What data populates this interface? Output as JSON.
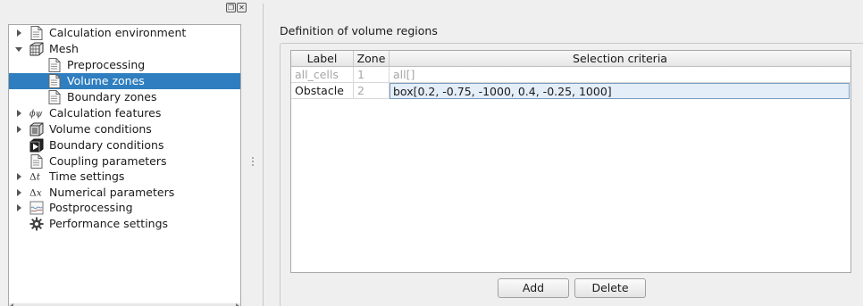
{
  "tree": {
    "items": [
      {
        "label": "Calculation environment",
        "icon": "document-icon",
        "expander": "collapsed",
        "indent": 0
      },
      {
        "label": "Mesh",
        "icon": "mesh-cube-icon",
        "expander": "expanded",
        "indent": 0
      },
      {
        "label": "Preprocessing",
        "icon": "document-icon",
        "expander": "none",
        "indent": 1
      },
      {
        "label": "Volume zones",
        "icon": "document-icon",
        "expander": "none",
        "indent": 1,
        "selected": true
      },
      {
        "label": "Boundary zones",
        "icon": "document-icon",
        "expander": "none",
        "indent": 1
      },
      {
        "label": "Calculation features",
        "icon": "phi-psi-icon",
        "expander": "collapsed",
        "indent": 0
      },
      {
        "label": "Volume conditions",
        "icon": "volume-cube-icon",
        "expander": "collapsed",
        "indent": 0
      },
      {
        "label": "Boundary conditions",
        "icon": "boundary-cube-icon",
        "expander": "none",
        "indent": 0
      },
      {
        "label": "Coupling parameters",
        "icon": "document-icon",
        "expander": "none",
        "indent": 0
      },
      {
        "label": "Time settings",
        "icon": "delta-t-icon",
        "expander": "collapsed",
        "indent": 0
      },
      {
        "label": "Numerical parameters",
        "icon": "delta-x-icon",
        "expander": "collapsed",
        "indent": 0
      },
      {
        "label": "Postprocessing",
        "icon": "chart-document-icon",
        "expander": "collapsed",
        "indent": 0
      },
      {
        "label": "Performance settings",
        "icon": "gear-icon",
        "expander": "none",
        "indent": 0
      }
    ]
  },
  "panel": {
    "title": "Definition of volume regions"
  },
  "table": {
    "headers": [
      "Label",
      "Zone",
      "Selection criteria"
    ],
    "rows": [
      {
        "label": "all_cells",
        "zone": "1",
        "criteria": "all[]",
        "disabled": true
      },
      {
        "label": "Obstacle",
        "zone": "2",
        "criteria": "box[0.2, -0.75, -1000, 0.4, -0.25, 1000]",
        "disabled": false
      }
    ]
  },
  "buttons": {
    "add": "Add",
    "delete": "Delete"
  },
  "colors": {
    "selection": "#2f7ec0",
    "disabled_text": "#a6a6a6",
    "edit_cell": "#e4eef8"
  }
}
